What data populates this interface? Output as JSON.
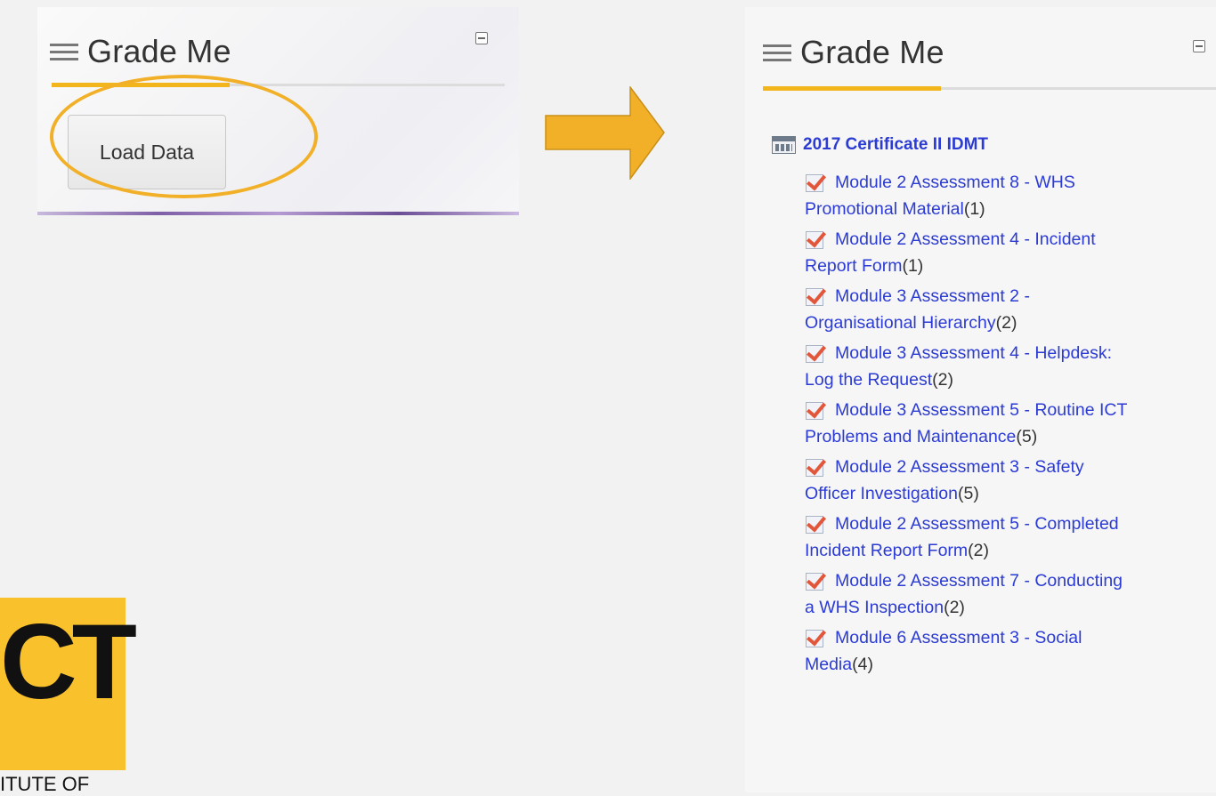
{
  "left_block": {
    "title": "Grade Me",
    "load_button_label": "Load Data"
  },
  "right_block": {
    "title": "Grade Me",
    "course": "2017 Certificate II IDMT",
    "assessments": [
      {
        "line1": "Module 2 Assessment 8 - WHS",
        "line2": "Promotional Material",
        "count": "(1)"
      },
      {
        "line1": "Module 2 Assessment 4 - Incident",
        "line2": "Report Form",
        "count": "(1)"
      },
      {
        "line1": "Module 3 Assessment 2 -",
        "line2": "Organisational Hierarchy",
        "count": "(2)"
      },
      {
        "line1": "Module 3 Assessment 4 - Helpdesk:",
        "line2": "Log the Request",
        "count": "(2)"
      },
      {
        "line1": "Module 3 Assessment 5 - Routine ICT",
        "line2": "Problems and Maintenance",
        "count": "(5)"
      },
      {
        "line1": "Module 2 Assessment 3 - Safety",
        "line2": "Officer Investigation",
        "count": "(5)"
      },
      {
        "line1": "Module 2 Assessment 5 - Completed",
        "line2": "Incident Report Form",
        "count": "(2)"
      },
      {
        "line1": "Module 2 Assessment 7 - Conducting",
        "line2": "a WHS Inspection",
        "count": "(2)"
      },
      {
        "line1": "Module 6 Assessment 3 - Social",
        "line2": "Media",
        "count": "(4)"
      }
    ]
  },
  "logo": {
    "letters": "CT",
    "caption": "ITUTE OF"
  },
  "colors": {
    "accent": "#f2b51c",
    "link": "#2b3bd4",
    "logo_bg": "#f9c12c",
    "arrow": "#f2b028"
  }
}
